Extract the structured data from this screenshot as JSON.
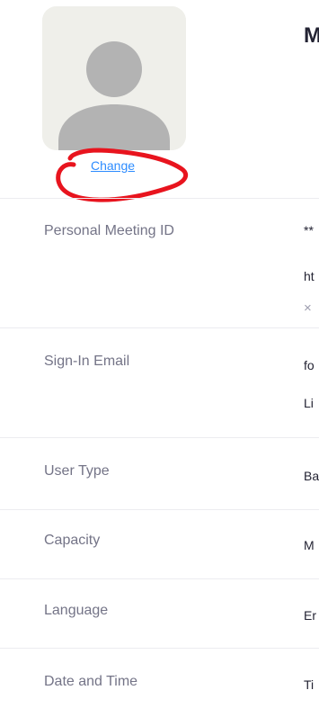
{
  "profile": {
    "display_name": "M",
    "change_label": "Change",
    "annotation_color": "#e8141e"
  },
  "rows": [
    {
      "label": "Personal Meeting ID",
      "values": [
        "**",
        "ht",
        "×"
      ]
    },
    {
      "label": "Sign-In Email",
      "values": [
        "fo",
        "Li"
      ]
    },
    {
      "label": "User Type",
      "values": [
        "Ba"
      ]
    },
    {
      "label": "Capacity",
      "values": [
        "M"
      ]
    },
    {
      "label": "Language",
      "values": [
        "Er"
      ]
    },
    {
      "label": "Date and Time",
      "values": [
        "Ti"
      ]
    }
  ]
}
